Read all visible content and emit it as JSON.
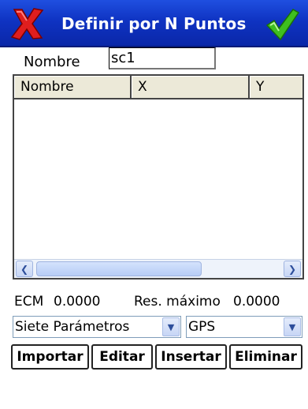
{
  "window": {
    "title": "Definir por N Puntos",
    "accent_color": "#0f33c2",
    "close_icon": "red-x-icon",
    "ok_icon": "green-check-icon"
  },
  "name_row": {
    "label": "Nombre",
    "value": "sc1"
  },
  "table": {
    "columns": [
      "Nombre",
      "X",
      "Y"
    ],
    "rows": []
  },
  "stats": {
    "ecm_label": "ECM",
    "ecm_value": "0.0000",
    "res_label": "Res. máximo",
    "res_value": "0.0000"
  },
  "dropdowns": {
    "transform_selected": "Siete Parámetros",
    "source_selected": "GPS"
  },
  "buttons": {
    "import": "Importar",
    "edit": "Editar",
    "insert": "Insertar",
    "delete": "Eliminar"
  }
}
